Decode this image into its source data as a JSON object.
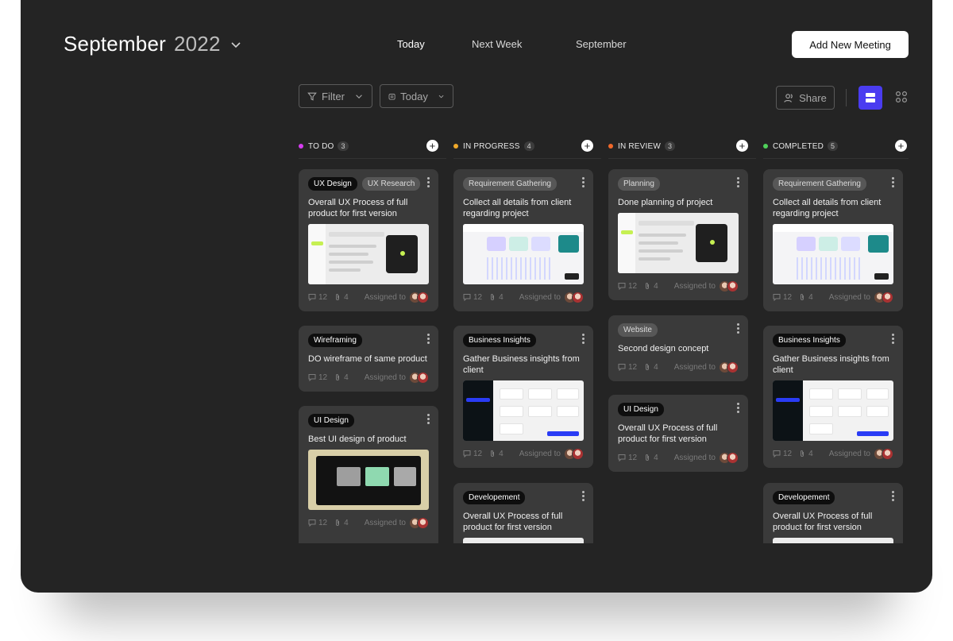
{
  "header": {
    "month": "September",
    "year": "2022",
    "nav": [
      "Today",
      "Next Week",
      "September"
    ],
    "add_button": "Add New Meeting"
  },
  "toolbar": {
    "filter_label": "Filter",
    "date_label": "Today",
    "share_label": "Share"
  },
  "colors": {
    "todo": "#d63df0",
    "in_progress": "#f0a92a",
    "in_review": "#f0682a",
    "completed": "#4fd15a",
    "accent": "#4a3cf0"
  },
  "columns": [
    {
      "title": "TO DO",
      "count": "3",
      "cards": [
        {
          "tags": [
            "UX Design",
            "UX Research"
          ],
          "title": "Overall UX Process of full product for first version",
          "comments": "12",
          "attachments": "4",
          "assigned": "Assigned to"
        },
        {
          "tags": [
            "Wireframing"
          ],
          "title": "DO wireframe of same product",
          "comments": "12",
          "attachments": "4",
          "assigned": "Assigned to"
        },
        {
          "tags": [
            "UI Design"
          ],
          "title": "Best UI design of product",
          "comments": "12",
          "attachments": "4",
          "assigned": "Assigned to"
        }
      ]
    },
    {
      "title": "IN PROGRESS",
      "count": "4",
      "cards": [
        {
          "tags": [
            "Requirement Gathering"
          ],
          "title": "Collect all details from client regarding project",
          "comments": "12",
          "attachments": "4",
          "assigned": "Assigned to"
        },
        {
          "tags": [
            "Business Insights"
          ],
          "title": "Gather Business insights from client",
          "comments": "12",
          "attachments": "4",
          "assigned": "Assigned to"
        },
        {
          "tags": [
            "Developement"
          ],
          "title": "Overall UX Process of full product for first version"
        }
      ]
    },
    {
      "title": "IN REVIEW",
      "count": "3",
      "cards": [
        {
          "tags": [
            "Planning"
          ],
          "title": "Done planning of project",
          "comments": "12",
          "attachments": "4",
          "assigned": "Assigned to"
        },
        {
          "tags": [
            "Website"
          ],
          "title": "Second design concept",
          "comments": "12",
          "attachments": "4",
          "assigned": "Assigned to"
        },
        {
          "tags": [
            "UI Design"
          ],
          "title": "Overall UX Process of full product for first version",
          "comments": "12",
          "attachments": "4",
          "assigned": "Assigned to"
        }
      ]
    },
    {
      "title": "COMPLETED",
      "count": "5",
      "cards": [
        {
          "tags": [
            "Requirement Gathering"
          ],
          "title": "Collect all details from client regarding project",
          "comments": "12",
          "attachments": "4",
          "assigned": "Assigned to"
        },
        {
          "tags": [
            "Business Insights"
          ],
          "title": "Gather Business insights from client",
          "comments": "12",
          "attachments": "4",
          "assigned": "Assigned to"
        },
        {
          "tags": [
            "Developement"
          ],
          "title": "Overall UX Process of full product for first version"
        }
      ]
    }
  ]
}
